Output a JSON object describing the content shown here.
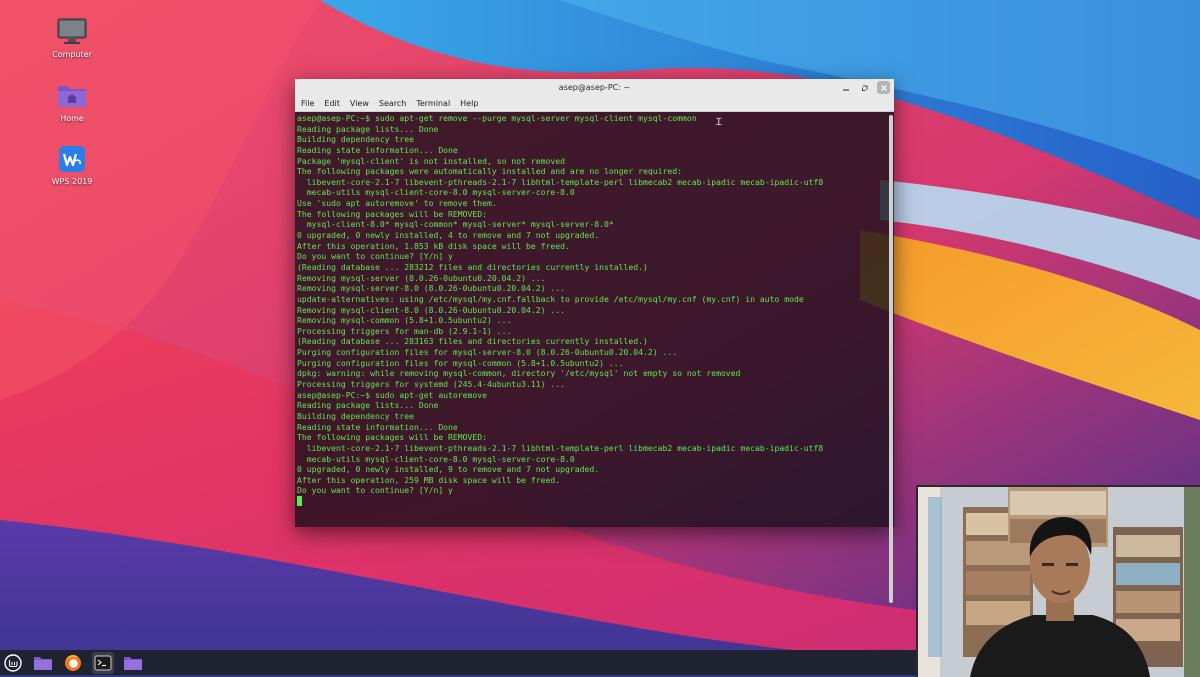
{
  "desktop": {
    "icons": [
      {
        "label": "Computer"
      },
      {
        "label": "Home"
      },
      {
        "label": "WPS 2019"
      }
    ]
  },
  "terminal": {
    "title": "asep@asep-PC: ~",
    "menu": [
      "File",
      "Edit",
      "View",
      "Search",
      "Terminal",
      "Help"
    ],
    "lines": [
      "asep@asep-PC:~$ sudo apt-get remove --purge mysql-server mysql-client mysql-common",
      "Reading package lists... Done",
      "Building dependency tree",
      "Reading state information... Done",
      "Package 'mysql-client' is not installed, so not removed",
      "The following packages were automatically installed and are no longer required:",
      "  libevent-core-2.1-7 libevent-pthreads-2.1-7 libhtml-template-perl libmecab2 mecab-ipadic mecab-ipadic-utf8",
      "  mecab-utils mysql-client-core-8.0 mysql-server-core-8.0",
      "Use 'sudo apt autoremove' to remove them.",
      "The following packages will be REMOVED:",
      "  mysql-client-8.0* mysql-common* mysql-server* mysql-server-8.0*",
      "0 upgraded, 0 newly installed, 4 to remove and 7 not upgraded.",
      "After this operation, 1.853 kB disk space will be freed.",
      "Do you want to continue? [Y/n] y",
      "(Reading database ... 283212 files and directories currently installed.)",
      "Removing mysql-server (8.0.26-0ubuntu0.20.04.2) ...",
      "Removing mysql-server-8.0 (8.0.26-0ubuntu0.20.04.2) ...",
      "update-alternatives: using /etc/mysql/my.cnf.fallback to provide /etc/mysql/my.cnf (my.cnf) in auto mode",
      "Removing mysql-client-8.0 (8.0.26-0ubuntu0.20.04.2) ...",
      "Removing mysql-common (5.8+1.0.5ubuntu2) ...",
      "Processing triggers for man-db (2.9.1-1) ...",
      "(Reading database ... 283163 files and directories currently installed.)",
      "Purging configuration files for mysql-server-8.0 (8.0.26-0ubuntu0.20.04.2) ...",
      "Purging configuration files for mysql-common (5.8+1.0.5ubuntu2) ...",
      "dpkg: warning: while removing mysql-common, directory '/etc/mysql' not empty so not removed",
      "Processing triggers for systemd (245.4-4ubuntu3.11) ...",
      "asep@asep-PC:~$ sudo apt-get autoremove",
      "Reading package lists... Done",
      "Building dependency tree",
      "Reading state information... Done",
      "The following packages will be REMOVED:",
      "  libevent-core-2.1-7 libevent-pthreads-2.1-7 libhtml-template-perl libmecab2 mecab-ipadic mecab-ipadic-utf8",
      "  mecab-utils mysql-client-core-8.0 mysql-server-core-8.0",
      "0 upgraded, 0 newly installed, 9 to remove and 7 not upgraded.",
      "After this operation, 259 MB disk space will be freed.",
      "Do you want to continue? [Y/n] y"
    ],
    "text_color": "#5ee84f"
  },
  "taskbar": {
    "items": [
      "mint-menu-icon",
      "files-icon",
      "firefox-icon",
      "terminal-icon",
      "folder-icon"
    ]
  },
  "colors": {
    "terminal_text": "#5ee84f",
    "titlebar": "#e9e9ea",
    "taskbar": "#1f2230"
  }
}
